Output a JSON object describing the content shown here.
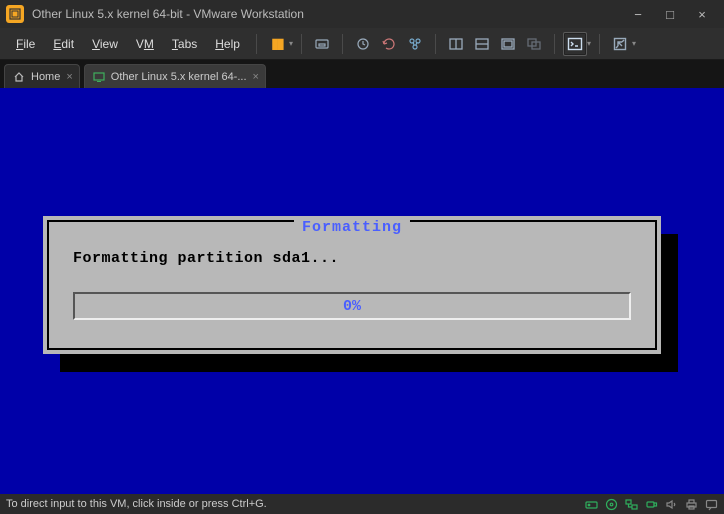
{
  "window": {
    "title": "Other Linux 5.x kernel 64-bit - VMware Workstation"
  },
  "menu": {
    "file": "File",
    "edit": "Edit",
    "view": "View",
    "vm": "VM",
    "tabs": "Tabs",
    "help": "Help"
  },
  "tabs": {
    "home": "Home",
    "vm_tab": "Other Linux 5.x kernel 64-..."
  },
  "dialog": {
    "title": "Formatting",
    "message": "Formatting partition sda1...",
    "progress_label": "0%",
    "progress_value": 0
  },
  "status": {
    "message": "To direct input to this VM, click inside or press Ctrl+G."
  },
  "colors": {
    "guest_bg": "#0000a8",
    "accent": "#f5a623",
    "tui_blue": "#4a5fff",
    "tray_green": "#2fae5d"
  }
}
